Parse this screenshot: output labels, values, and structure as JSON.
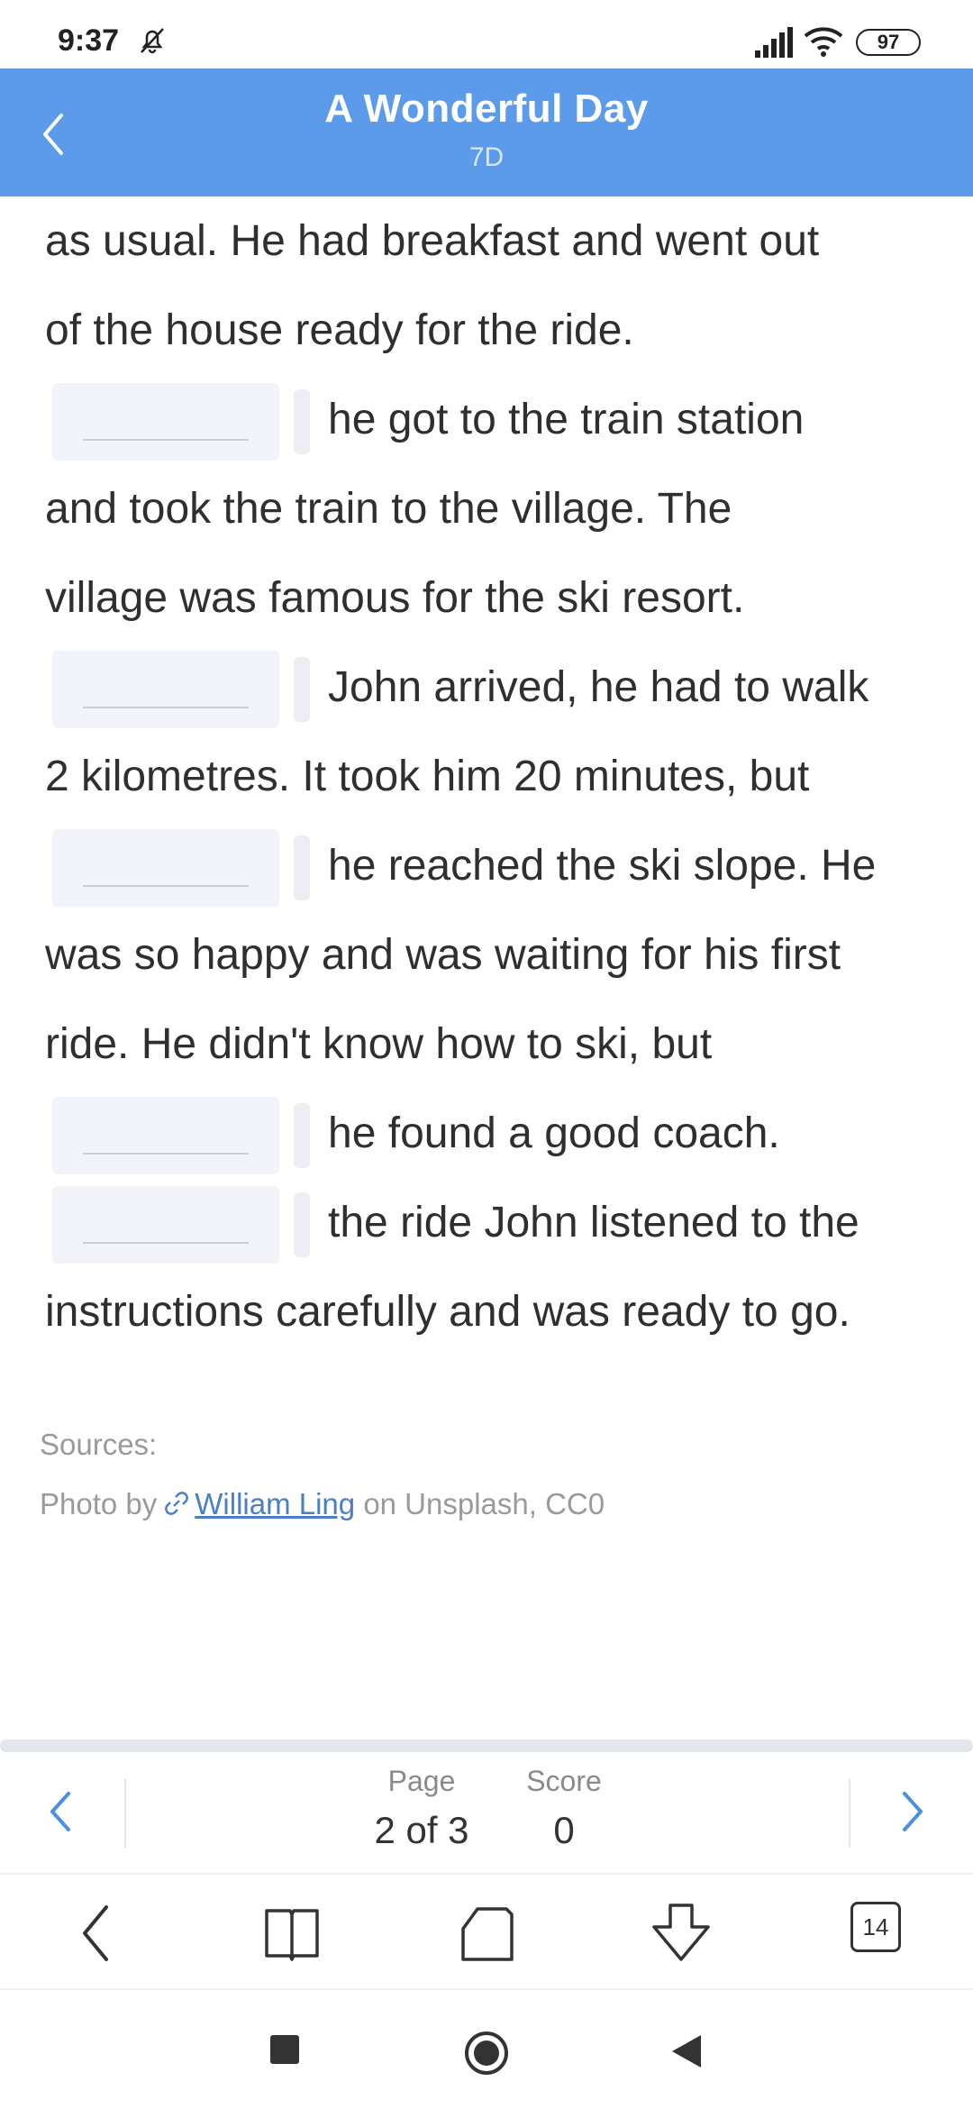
{
  "status_bar": {
    "time": "9:37",
    "battery": "97",
    "icons": [
      "mute-alarm-icon",
      "signal-icon",
      "wifi-icon",
      "battery-icon"
    ]
  },
  "header": {
    "title": "A Wonderful Day",
    "subtitle": "7D",
    "back_icon": "chevron-left-icon",
    "background": "#5b9be9"
  },
  "reading": {
    "lines": [
      {
        "has_gap": false,
        "text": "as usual. He had breakfast and went out"
      },
      {
        "has_gap": false,
        "text": "of the house ready for the ride."
      },
      {
        "has_gap": true,
        "text": "he got to the train station"
      },
      {
        "has_gap": false,
        "text": "and took the train to the village. The"
      },
      {
        "has_gap": false,
        "text": "village was famous for the ski resort."
      },
      {
        "has_gap": true,
        "text": "John arrived, he had to walk"
      },
      {
        "has_gap": false,
        "text": "2 kilometres. It took him 20 minutes, but"
      },
      {
        "has_gap": true,
        "text": "he reached the ski slope. He"
      },
      {
        "has_gap": false,
        "text": "was so happy and was waiting for his first"
      },
      {
        "has_gap": false,
        "text": "ride. He didn't know how to ski, but"
      },
      {
        "has_gap": true,
        "text": "he found a good coach."
      },
      {
        "has_gap": true,
        "text": "the ride John listened to the"
      },
      {
        "has_gap": false,
        "text": "instructions carefully and was ready to go."
      }
    ]
  },
  "sources": {
    "label": "Sources:",
    "credit_prefix": "Photo by",
    "credit_link": "William Ling",
    "credit_suffix": "on Unsplash, CC0"
  },
  "pager": {
    "page_label": "Page",
    "page_value": "2 of 3",
    "score_label": "Score",
    "score_value": "0",
    "accent": "#4a8fe0"
  },
  "browser_bar": {
    "buttons": [
      "back-icon",
      "bookmarks-icon",
      "home-icon",
      "download-icon"
    ],
    "tab_count": "14"
  },
  "system_nav": [
    "recents-icon",
    "home-icon",
    "back-icon"
  ]
}
